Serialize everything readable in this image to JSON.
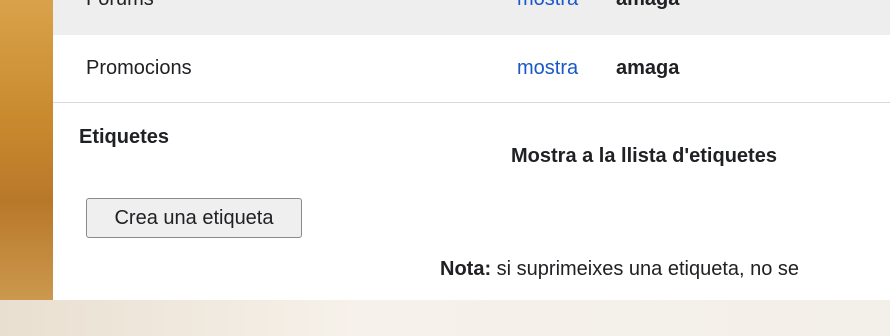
{
  "categories": [
    {
      "label": "Fòrums",
      "show": "mostra",
      "hide": "amaga"
    },
    {
      "label": "Promocions",
      "show": "mostra",
      "hide": "amaga"
    }
  ],
  "labels_section": {
    "title": "Etiquetes",
    "column_title": "Mostra a la llista d'etiquetes",
    "create_button": "Crea una etiqueta",
    "note_prefix": "Nota:",
    "note_text": " si suprimeixes una etiqueta, no se"
  }
}
